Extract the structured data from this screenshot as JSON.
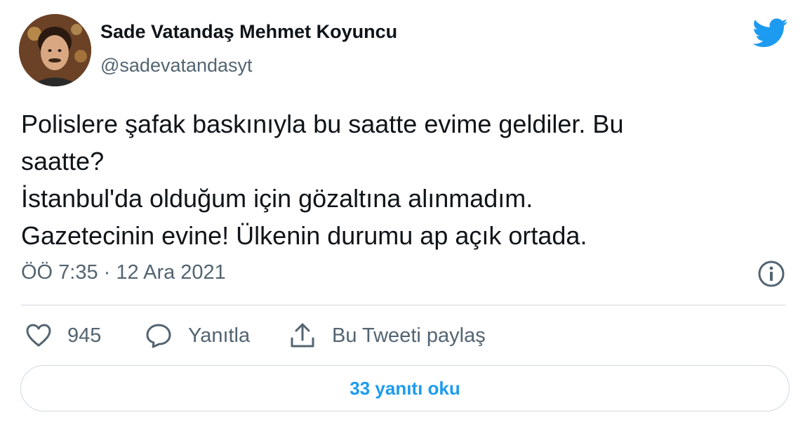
{
  "author": {
    "name": "Sade Vatandaş Mehmet Koyuncu",
    "handle": "@sadevatandasyt",
    "avatar_alt": ""
  },
  "brand": {
    "icon": "twitter-bird-icon",
    "color": "#1d9bf0"
  },
  "tweet": {
    "text": "Polislere şafak baskınıyla bu saatte evime geldiler. Bu\nsaatte?\nİstanbul'da olduğum için gözaltına alınmadım.\nGazetecinin evine! Ülkenin durumu ap açık ortada.",
    "timestamp": "ÖÖ 7:35 · 12 Ara 2021"
  },
  "actions": {
    "like_count": "945",
    "reply_label": "Yanıtla",
    "share_label": "Bu Tweeti paylaş"
  },
  "footer": {
    "read_replies_label": "33 yanıtı oku"
  },
  "colors": {
    "text_primary": "#0f1419",
    "text_secondary": "#536471",
    "accent": "#1d9bf0",
    "border": "#cfd9de"
  }
}
